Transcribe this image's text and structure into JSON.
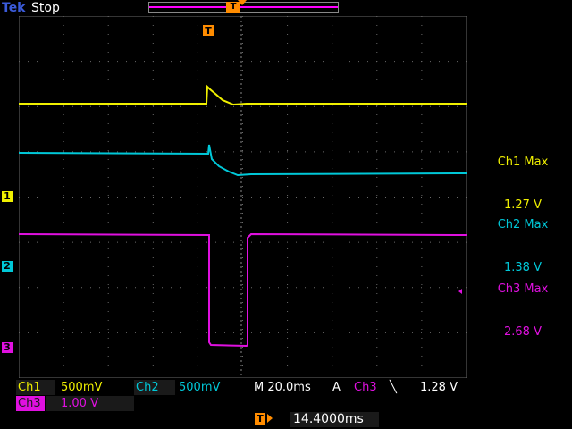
{
  "header": {
    "brand": "Tek",
    "status": "Stop"
  },
  "trigger": {
    "marker_label": "T"
  },
  "readouts": [
    {
      "label": "Ch1 Max",
      "value": "1.27 V",
      "color": "#f0f000"
    },
    {
      "label": "Ch2 Max",
      "value": "1.38 V",
      "color": "#00c8d8"
    },
    {
      "label": "Ch3 Max",
      "value": "2.68 V",
      "color": "#e010e0"
    }
  ],
  "channel_markers": [
    "1",
    "2",
    "3"
  ],
  "bottom": {
    "ch1_label": "Ch1",
    "ch1_scale": "500mV",
    "ch2_label": "Ch2",
    "ch2_scale": "500mV",
    "timebase": "M 20.0ms",
    "trigger_mode": "A",
    "trigger_source": "Ch3",
    "trigger_slope": "╲",
    "trigger_level": "1.28 V",
    "ch3_label": "Ch3",
    "ch3_scale": "1.00 V",
    "trigger_position": "14.4000ms"
  },
  "colors": {
    "ch1": "#f0f000",
    "ch2": "#00c8d8",
    "ch3": "#e010e0",
    "trigger": "#ff8c00",
    "grid": "#6a6a6a"
  }
}
